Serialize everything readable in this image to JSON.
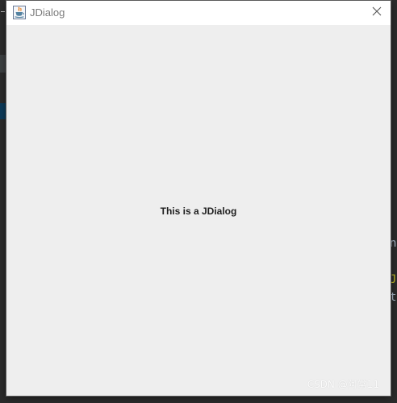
{
  "window": {
    "title": "JDialog",
    "icon": "java-coffee-cup-icon",
    "close_icon": "close-icon"
  },
  "content": {
    "message": "This is a JDialog"
  },
  "background": {
    "code_fragments": [
      "ns",
      "J",
      "ts"
    ]
  },
  "watermark": "CSDN @阿常11"
}
